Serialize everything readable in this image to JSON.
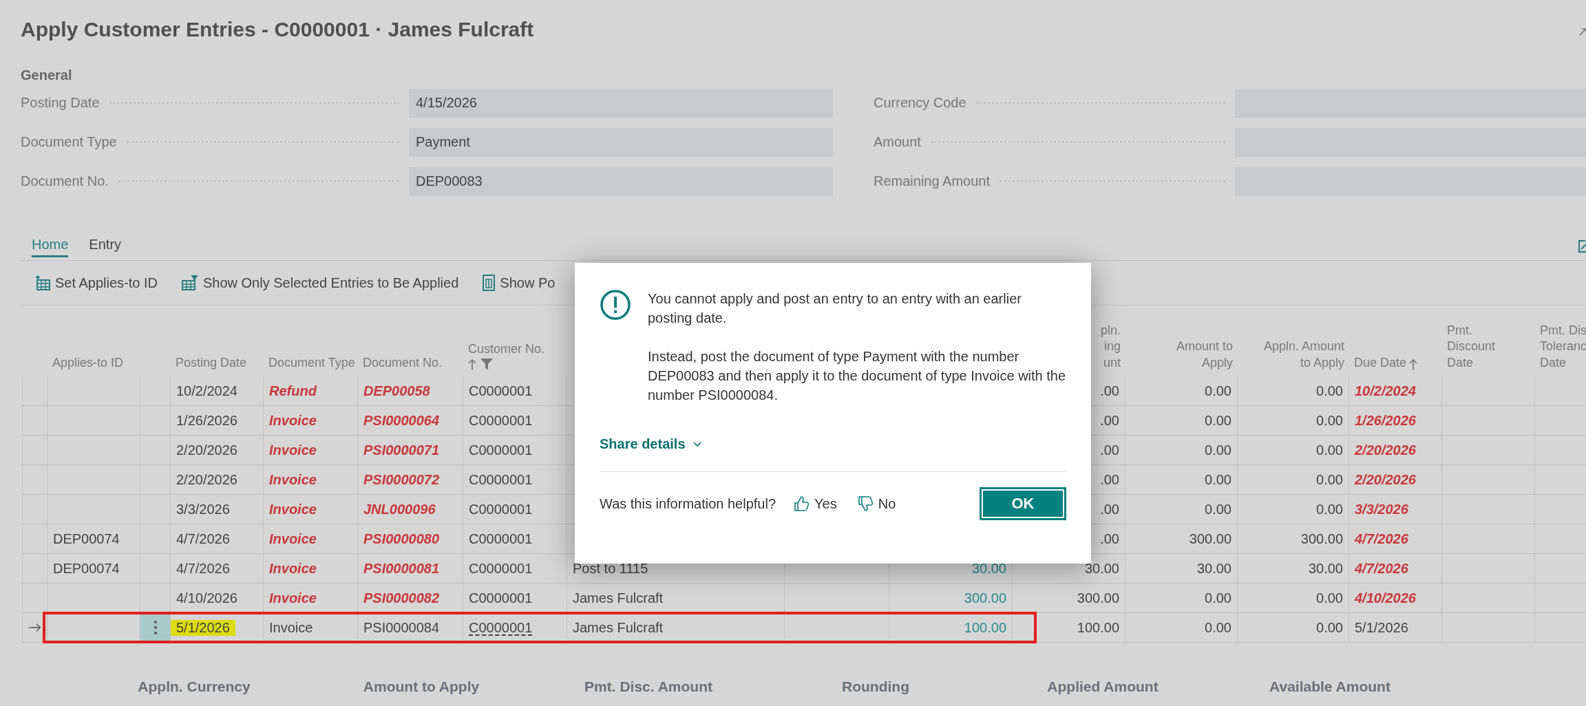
{
  "window": {
    "title": "Apply Customer Entries - C0000001 · James Fulcraft"
  },
  "general": {
    "heading": "General",
    "fields_left": [
      {
        "label": "Posting Date",
        "value": "4/15/2026"
      },
      {
        "label": "Document Type",
        "value": "Payment"
      },
      {
        "label": "Document No.",
        "value": "DEP00083"
      }
    ],
    "fields_right": [
      {
        "label": "Currency Code"
      },
      {
        "label": "Amount"
      },
      {
        "label": "Remaining Amount"
      }
    ]
  },
  "tabs": [
    {
      "label": "Home",
      "selected": true
    },
    {
      "label": "Entry",
      "selected": false
    }
  ],
  "actions": [
    {
      "label": "Set Applies-to ID"
    },
    {
      "label": "Show Only Selected Entries to Be Applied"
    },
    {
      "label": "Show Po"
    }
  ],
  "table": {
    "columns": [
      {
        "label": "Applies-to ID",
        "sorted": false,
        "filtered": false
      },
      {
        "label": "Posting Date",
        "sorted": false,
        "filtered": false
      },
      {
        "label": "Document Type",
        "sorted": false,
        "filtered": false
      },
      {
        "label": "Document No.",
        "sorted": false,
        "filtered": false
      },
      {
        "label": "Customer No.",
        "sorted": true,
        "filtered": true
      },
      {
        "label": "pln.\ning\nunt",
        "sorted": false,
        "filtered": false
      },
      {
        "label": "Amount to\nApply",
        "sorted": false,
        "filtered": false
      },
      {
        "label": "Appln. Amount\nto Apply",
        "sorted": false,
        "filtered": false
      },
      {
        "label": "Due Date",
        "sorted": true,
        "filtered": false
      },
      {
        "label": "Pmt.\nDiscount\nDate",
        "sorted": false,
        "filtered": false
      },
      {
        "label": "Pmt. Dis\nToleranc\nDate",
        "sorted": false,
        "filtered": false
      }
    ],
    "rows": [
      {
        "selected": false,
        "marked": false,
        "overdue": true,
        "posting_date": "10/2/2024",
        "document_type": "Refund",
        "document_no": "DEP00058",
        "customer_no": "C0000001",
        "remaining_amount": ".00",
        "amount_to_apply": "0.00",
        "appln_amount_to_apply": "0.00",
        "due_date": "10/2/2024"
      },
      {
        "selected": false,
        "marked": false,
        "overdue": true,
        "posting_date": "1/26/2026",
        "document_type": "Invoice",
        "document_no": "PSI0000064",
        "customer_no": "C0000001",
        "remaining_amount": ".00",
        "amount_to_apply": "0.00",
        "appln_amount_to_apply": "0.00",
        "due_date": "1/26/2026"
      },
      {
        "selected": false,
        "marked": false,
        "overdue": true,
        "posting_date": "2/20/2026",
        "document_type": "Invoice",
        "document_no": "PSI0000071",
        "customer_no": "C0000001",
        "remaining_amount": ".00",
        "amount_to_apply": "0.00",
        "appln_amount_to_apply": "0.00",
        "due_date": "2/20/2026"
      },
      {
        "selected": false,
        "marked": false,
        "overdue": true,
        "posting_date": "2/20/2026",
        "document_type": "Invoice",
        "document_no": "PSI0000072",
        "customer_no": "C0000001",
        "remaining_amount": ".00",
        "amount_to_apply": "0.00",
        "appln_amount_to_apply": "0.00",
        "due_date": "2/20/2026"
      },
      {
        "selected": false,
        "marked": false,
        "overdue": true,
        "posting_date": "3/3/2026",
        "document_type": "Invoice",
        "document_no": "JNL000096",
        "customer_no": "C0000001",
        "remaining_amount": ".00",
        "amount_to_apply": "0.00",
        "appln_amount_to_apply": "0.00",
        "due_date": "3/3/2026"
      },
      {
        "selected": false,
        "marked": false,
        "overdue": true,
        "applies_to_id": "DEP00074",
        "posting_date": "4/7/2026",
        "document_type": "Invoice",
        "document_no": "PSI0000080",
        "customer_no": "C0000001",
        "remaining_amount": ".00",
        "amount_to_apply": "300.00",
        "appln_amount_to_apply": "300.00",
        "due_date": "4/7/2026"
      },
      {
        "selected": false,
        "marked": false,
        "overdue": true,
        "applies_to_id": "DEP00074",
        "posting_date": "4/7/2026",
        "document_type": "Invoice",
        "document_no": "PSI0000081",
        "customer_no": "C0000001",
        "description": "Post to 1115",
        "original_amount": "30.00",
        "remaining_amount": "30.00",
        "amount_to_apply": "30.00",
        "appln_amount_to_apply": "30.00",
        "due_date": "4/7/2026"
      },
      {
        "selected": false,
        "marked": false,
        "overdue": true,
        "posting_date": "4/10/2026",
        "document_type": "Invoice",
        "document_no": "PSI0000082",
        "customer_no": "C0000001",
        "description": "James Fulcraft",
        "original_amount": "300.00",
        "remaining_amount": "300.00",
        "amount_to_apply": "0.00",
        "appln_amount_to_apply": "0.00",
        "due_date": "4/10/2026"
      },
      {
        "selected": true,
        "marked": true,
        "overdue": false,
        "posting_date": "5/1/2026",
        "document_type": "Invoice",
        "document_no": "PSI0000084",
        "customer_no": "C0000001",
        "description": "James Fulcraft",
        "original_amount": "100.00",
        "remaining_amount": "100.00",
        "amount_to_apply": "0.00",
        "appln_amount_to_apply": "0.00",
        "due_date": "5/1/2026"
      }
    ]
  },
  "totals": [
    "Appln. Currency",
    "Amount to Apply",
    "Pmt. Disc. Amount",
    "Rounding",
    "Applied Amount",
    "Available Amount"
  ],
  "dialog": {
    "message": "You cannot apply and post an entry to an entry with an earlier posting date.",
    "detail": "Instead, post the document of type Payment with the number DEP00083 and then apply it to the document of type Invoice with the number PSI0000084.",
    "share_label": "Share details",
    "feedback_question": "Was this information helpful?",
    "yes_label": "Yes",
    "no_label": "No",
    "ok_label": "OK"
  }
}
